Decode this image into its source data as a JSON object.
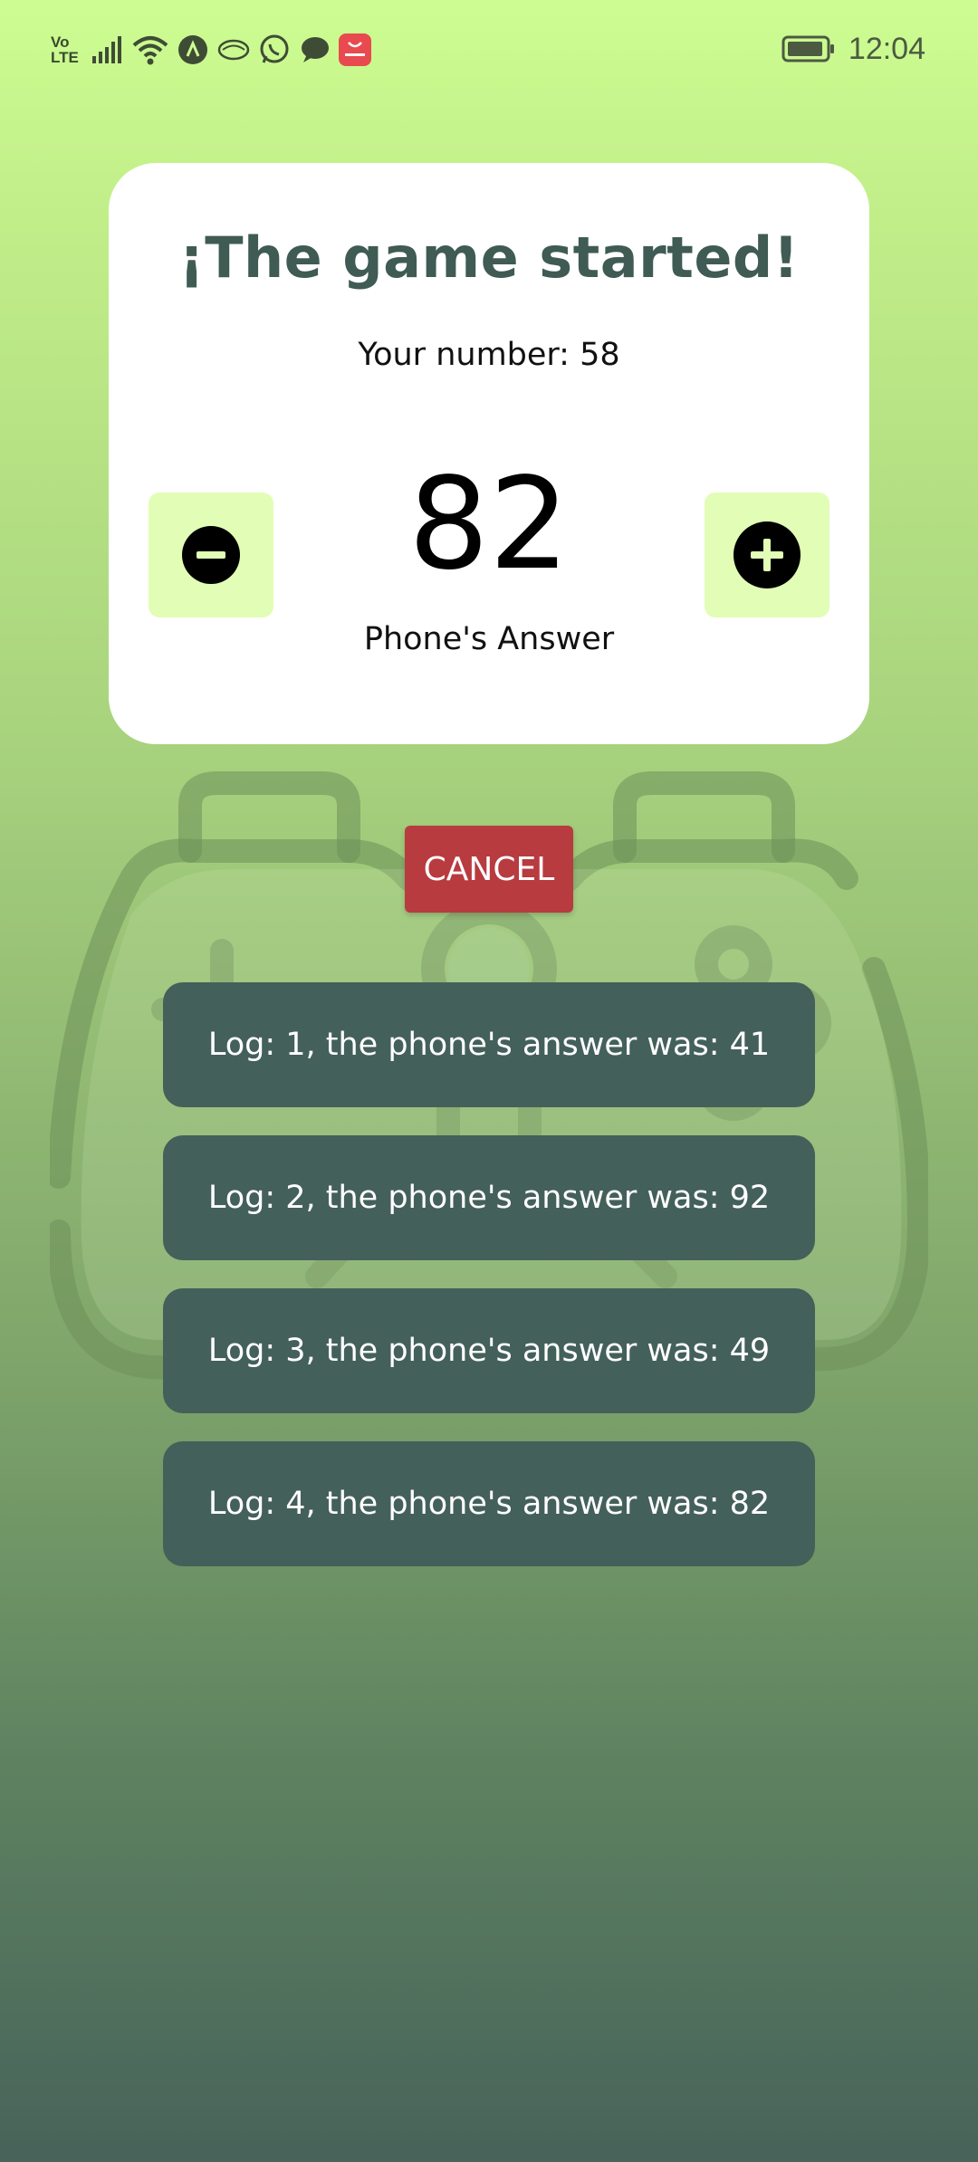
{
  "status_bar": {
    "network_label": "Vo\nLTE",
    "time": "12:04",
    "icons": [
      "volte-icon",
      "signal-icon",
      "wifi-icon",
      "app-a-icon",
      "cloud-icon",
      "whatsapp-icon",
      "message-icon",
      "app-gallery-icon",
      "battery-icon"
    ]
  },
  "card": {
    "title": "¡The game started!",
    "your_number_text": "Your number: 58",
    "current_guess": "82",
    "guess_label": "Phone's Answer",
    "decrement_icon": "minus-circle-icon",
    "increment_icon": "plus-circle-icon"
  },
  "cancel_label": "CANCEL",
  "logs": [
    "Log: 1, the phone's answer was: 41",
    "Log: 2, the phone's answer was: 92",
    "Log: 3, the phone's answer was: 49",
    "Log: 4, the phone's answer was: 82"
  ],
  "colors": {
    "background_top": "#cdfd92",
    "background_bottom": "#47635a",
    "card": "#ffffff",
    "title": "#3f5b53",
    "step_button": "#e2fdb6",
    "cancel": "#b83b40",
    "log_item": "#44605a"
  }
}
